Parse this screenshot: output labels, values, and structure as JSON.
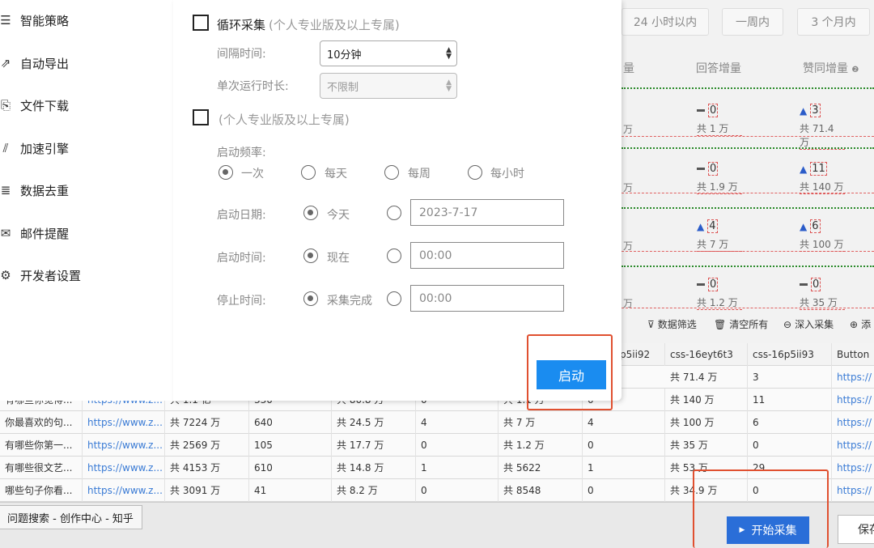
{
  "time_tabs": [
    "24 小时以内",
    "一周内",
    "3 个月内"
  ],
  "headers": {
    "answers": "回答增量",
    "likes": "赞同增量",
    "partial": "量"
  },
  "partial_cells": [
    "万",
    "万",
    "万",
    "万"
  ],
  "counters": [
    {
      "a_sym": "=",
      "a_num": "0",
      "a_tot": "共 1 万",
      "b_sym": "▲",
      "b_num": "3",
      "b_tot": "共 71.4 万"
    },
    {
      "a_sym": "=",
      "a_num": "0",
      "a_tot": "共 1.9 万",
      "b_sym": "▲",
      "b_num": "11",
      "b_tot": "共 140 万"
    },
    {
      "a_sym": "▲",
      "a_num": "4",
      "a_tot": "共 7 万",
      "b_sym": "▲",
      "b_num": "6",
      "b_tot": "共 100 万"
    },
    {
      "a_sym": "=",
      "a_num": "0",
      "a_tot": "共 1.2 万",
      "b_sym": "=",
      "b_num": "0",
      "b_tot": "共 35 万"
    }
  ],
  "toolbar": {
    "filter": "数据筛选",
    "clear": "清空所有",
    "deep": "深入采集",
    "add": "添"
  },
  "table": {
    "headers": [
      "p5ii92",
      "css-16eyt6t3",
      "css-16p5ii93",
      "Button"
    ],
    "rows": [
      [
        "",
        "",
        "",
        "",
        "",
        "",
        "",
        "共 71.4 万",
        "3",
        "https://"
      ],
      [
        "有哪些你觉得...",
        "https://www.z...",
        "共 1.1 亿",
        "330",
        "共 80.8 万",
        "0",
        "共 1.1 万",
        "0",
        "共 140 万",
        "11",
        "https://"
      ],
      [
        "你最喜欢的句...",
        "https://www.z...",
        "共 7224 万",
        "640",
        "共 24.5 万",
        "4",
        "共 7 万",
        "4",
        "共 100 万",
        "6",
        "https://"
      ],
      [
        "有哪些你第一...",
        "https://www.z...",
        "共 2569 万",
        "105",
        "共 17.7 万",
        "0",
        "共 1.2 万",
        "0",
        "共 35 万",
        "0",
        "https://"
      ],
      [
        "有哪些很文艺...",
        "https://www.z...",
        "共 4153 万",
        "610",
        "共 14.8 万",
        "1",
        "共 5622",
        "1",
        "共 53 万",
        "29",
        "https://"
      ],
      [
        "哪些句子你看...",
        "https://www.z...",
        "共 3091 万",
        "41",
        "共 8.2 万",
        "0",
        "共 8548",
        "0",
        "共 34.9 万",
        "0",
        "https://"
      ]
    ]
  },
  "sidebar": {
    "items": [
      "智能策略",
      "自动导出",
      "文件下载",
      "加速引擎",
      "数据去重",
      "邮件提醒",
      "开发者设置"
    ]
  },
  "modal": {
    "loop_title": "循环采集",
    "loop_note": "(个人专业版及以上专属)",
    "interval_label": "间隔时间:",
    "interval_value": "10分钟",
    "duration_label": "单次运行时长:",
    "duration_value": "不限制",
    "sched_note": "(个人专业版及以上专属)",
    "freq_label": "启动频率:",
    "freq_options": [
      "一次",
      "每天",
      "每周",
      "每小时"
    ],
    "date_label": "启动日期:",
    "date_today": "今天",
    "date_value": "2023-7-17",
    "time_label": "启动时间:",
    "time_now": "现在",
    "time_value": "00:00",
    "stop_label": "停止时间:",
    "stop_done": "采集完成",
    "stop_value": "00:00",
    "start_button": "启动"
  },
  "bottom": {
    "page_tab": "问题搜索 - 创作中心 - 知乎",
    "start_collect": "开始采集",
    "save": "保存"
  }
}
